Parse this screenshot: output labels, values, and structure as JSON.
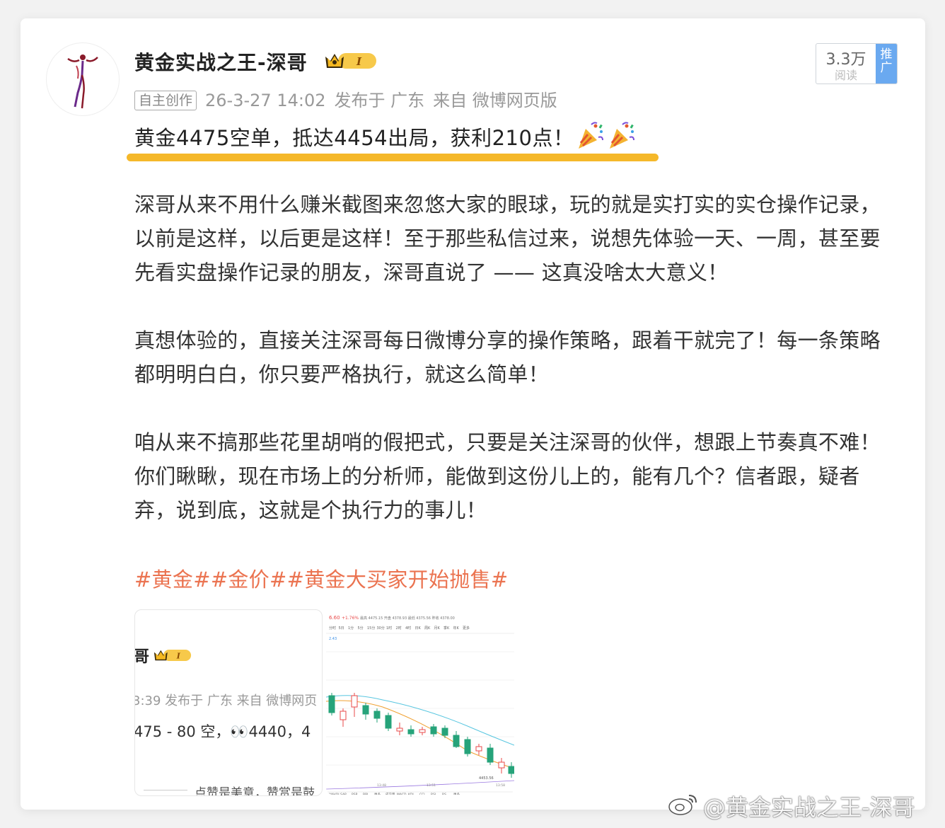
{
  "post": {
    "author": "黄金实战之王-深哥",
    "tag": "自主创作",
    "date": "26-3-27 14:02",
    "location": "发布于 广东",
    "source": "来自 微博网页版",
    "reads_count": "3.3万",
    "reads_label": "阅读",
    "promote": "推广",
    "headline": "黄金4475空单，抵达4454出局，获利210点！",
    "paragraphs": [
      "深哥从来不用什么赚米截图来忽悠大家的眼球，玩的就是实打实的实仓操作记录，以前是这样，以后更是这样！至于那些私信过来，说想先体验一天、一周，甚至要先看实盘操作记录的朋友，深哥直说了 —— 这真没啥太大意义！",
      "真想体验的，直接关注深哥每日微博分享的操作策略，跟着干就完了！每一条策略都明明白白，你只要严格执行，就这么简单！",
      "咱从来不搞那些花里胡哨的假把式，只要是关注深哥的伙伴，想跟上节奏真不难！你们瞅瞅，现在市场上的分析师，能做到这份儿上的，能有几个？信者跟，疑者弃，说到底，这就是个执行力的事儿！"
    ],
    "hashtags": [
      "#黄金#",
      "#金价#",
      "#黄金大买家开始抛售#"
    ],
    "vip_level": "I"
  },
  "thumb1": {
    "name_fragment": "哥",
    "meta_fragment": "3:39 发布于 广东 来自 微博网页",
    "content_fragment": "475 - 80 空，👀4440，4",
    "footer_fragment": "点赞是美意，赞赏是鼓"
  },
  "thumb2": {
    "price_change": "6.60",
    "pct_change": "+1.76%",
    "stats": "最高 4475.15 开盘 4378.93 最低 4375.56 昨收 4378.00",
    "periods": [
      "分时",
      "5日",
      "1分",
      "5分",
      "15分",
      "30分",
      "1时",
      "2时",
      "4时",
      "日K",
      "周K",
      "月K",
      "季K",
      "年K",
      "更多"
    ],
    "axis_top": "2.43",
    "low_label": "4453.56",
    "indicators": [
      "MAVOL",
      "SAR",
      "PSR",
      "BBI",
      "更多",
      "成交量",
      "MACD",
      "KDJ",
      "CCI",
      "RSI",
      "RS",
      "更多"
    ],
    "times": [
      "13:48",
      "13:51",
      "13:58"
    ]
  },
  "watermark": "@黄金实战之王-深哥",
  "colors": {
    "hashtag": "#eb7350",
    "underline": "#f5b82a",
    "promote_bg": "#6aa9f0",
    "candle_up": "#e94a4a",
    "candle_down": "#26a37a"
  }
}
